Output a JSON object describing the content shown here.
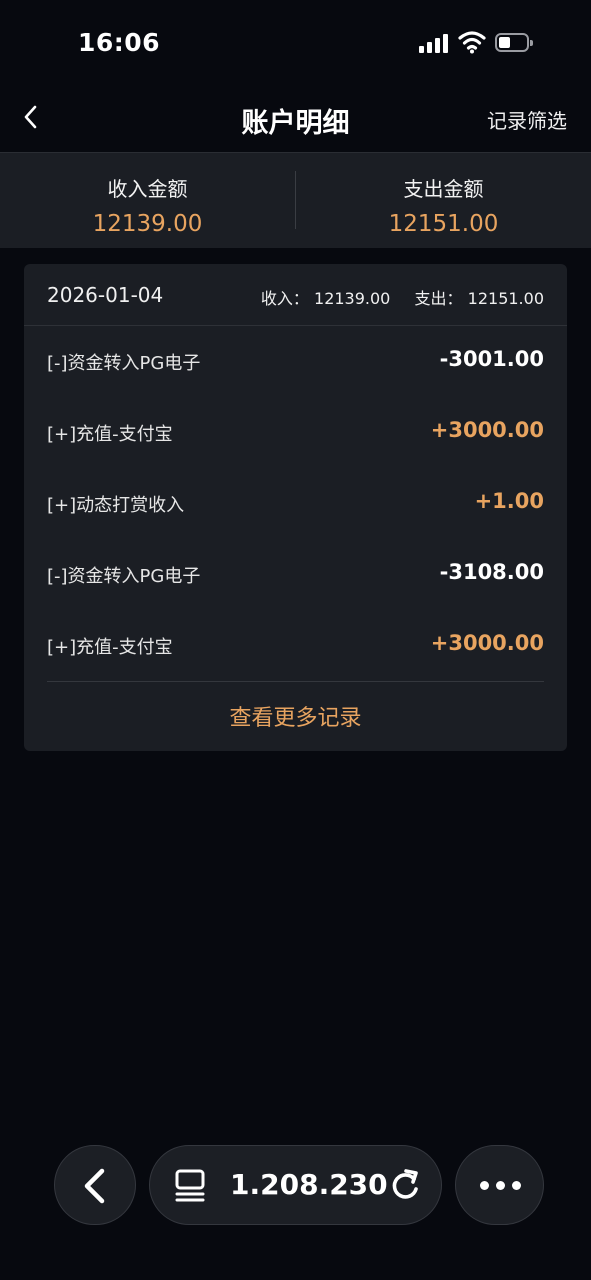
{
  "status_bar": {
    "time": "16:06"
  },
  "header": {
    "title": "账户明细",
    "filter_label": "记录筛选"
  },
  "summary": {
    "income_label": "收入金额",
    "income_value": "12139.00",
    "expense_label": "支出金额",
    "expense_value": "12151.00"
  },
  "card": {
    "date": "2026-01-04",
    "income_label": "收入：",
    "income_value": "12139.00",
    "expense_label": "支出：",
    "expense_value": "12151.00",
    "records": [
      {
        "label": "[-]资金转入PG电子",
        "amount": "-3001.00"
      },
      {
        "label": "[+]充值-支付宝",
        "amount": "+3000.00"
      },
      {
        "label": "[+]动态打赏收入",
        "amount": "+1.00"
      },
      {
        "label": "[-]资金转入PG电子",
        "amount": "-3108.00"
      },
      {
        "label": "[+]充值-支付宝",
        "amount": "+3000.00"
      }
    ],
    "more_label": "查看更多记录"
  },
  "browser_bar": {
    "url": "1.208.230",
    "icons": [
      "back-arrow-icon",
      "tabs-icon",
      "reload-icon",
      "more-dots-icon"
    ]
  },
  "colors": {
    "background": "#07090f",
    "panel": "#1b1e24",
    "accent_orange": "#e8a460",
    "text_primary": "#ffffff"
  }
}
